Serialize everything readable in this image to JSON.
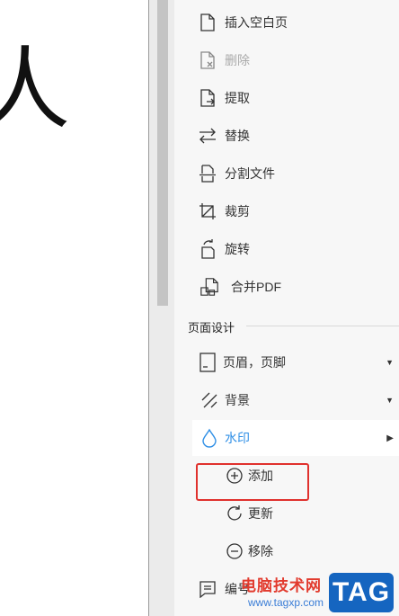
{
  "document": {
    "visible_glyph": "人"
  },
  "menu": {
    "items": [
      {
        "label": "插入空白页",
        "icon": "insert-page-icon",
        "disabled": false
      },
      {
        "label": "删除",
        "icon": "delete-page-icon",
        "disabled": true
      },
      {
        "label": "提取",
        "icon": "extract-page-icon",
        "disabled": false
      },
      {
        "label": "替换",
        "icon": "replace-icon",
        "disabled": false
      },
      {
        "label": "分割文件",
        "icon": "split-file-icon",
        "disabled": false
      },
      {
        "label": "裁剪",
        "icon": "crop-icon",
        "disabled": false
      },
      {
        "label": "旋转",
        "icon": "rotate-icon",
        "disabled": false
      },
      {
        "label": "合并PDF",
        "icon": "merge-pdf-icon",
        "disabled": false
      }
    ]
  },
  "page_design": {
    "title": "页面设计",
    "header_footer": {
      "label": "页眉，页脚",
      "icon": "header-footer-icon"
    },
    "background": {
      "label": "背景",
      "icon": "background-icon"
    },
    "watermark": {
      "label": "水印",
      "icon": "water-drop-icon",
      "active_color": "#2f8fe6"
    },
    "watermark_sub": {
      "add": {
        "label": "添加",
        "icon": "plus-circle-icon"
      },
      "update": {
        "label": "更新",
        "icon": "refresh-icon"
      },
      "remove": {
        "label": "移除",
        "icon": "minus-circle-icon"
      }
    },
    "numbering": {
      "label": "编号",
      "icon": "numbering-icon"
    }
  },
  "site_watermark": {
    "name": "电脑技术网",
    "url": "www.tagxp.com",
    "badge": "TAG"
  },
  "colors": {
    "highlight_box": "#e0312d",
    "active": "#2f8fe6"
  }
}
